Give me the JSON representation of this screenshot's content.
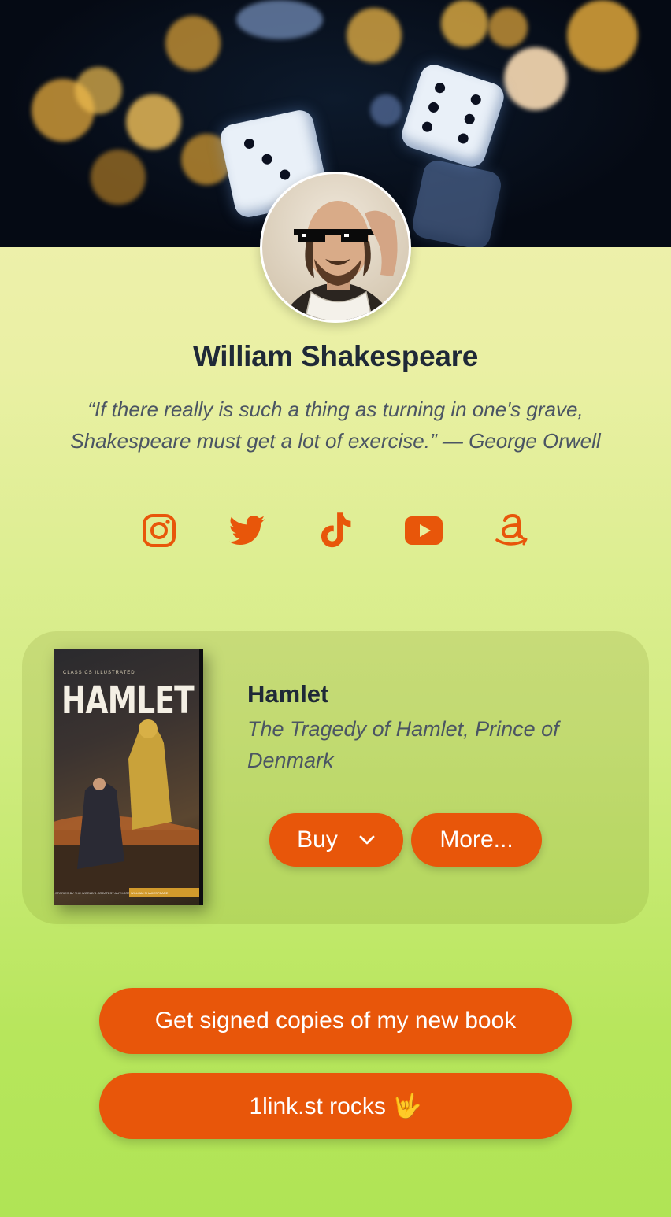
{
  "profile": {
    "name": "William Shakespeare",
    "quote": "“If there really is such a thing as turning in one's grave, Shakespeare must get a lot of exercise.” — George Orwell"
  },
  "socials": [
    {
      "icon": "instagram-icon"
    },
    {
      "icon": "twitter-icon"
    },
    {
      "icon": "tiktok-icon"
    },
    {
      "icon": "youtube-icon"
    },
    {
      "icon": "amazon-icon"
    }
  ],
  "book": {
    "cover_series": "CLASSICS ILLUSTRATED",
    "cover_title": "HAMLET",
    "cover_footer_left": "STORIES BY THE WORLD'S GREATEST AUTHORS",
    "cover_footer_right": "WILLIAM SHAKESPEARE",
    "title": "Hamlet",
    "subtitle": "The Tragedy of Hamlet, Prince of Denmark",
    "buy_label": "Buy",
    "more_label": "More..."
  },
  "links": [
    {
      "label": "Get signed copies of my new book"
    },
    {
      "label": "1link.st rocks 🤟"
    }
  ],
  "colors": {
    "accent": "#e8560a",
    "text": "#1f2937",
    "muted": "#4b5563"
  }
}
